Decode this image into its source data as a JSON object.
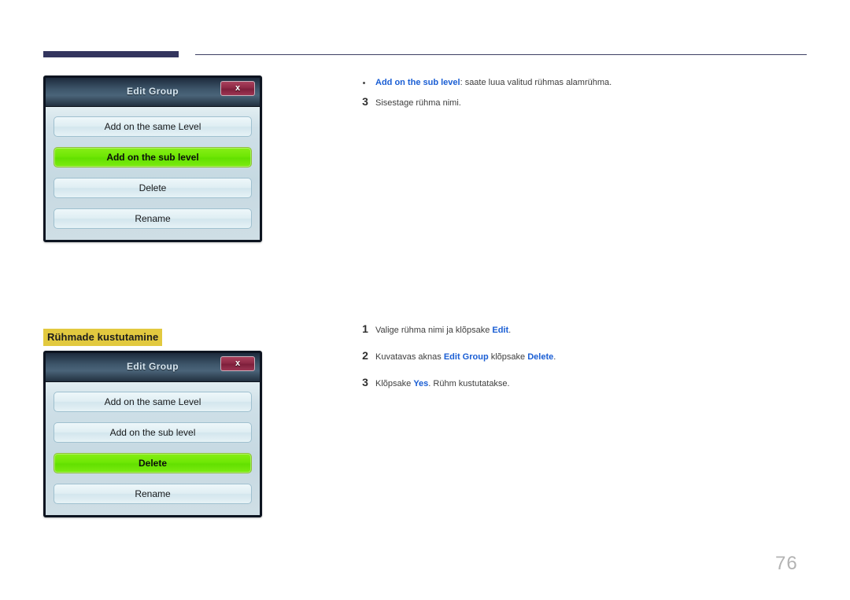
{
  "page": {
    "number": "76",
    "heading": "Rühmade kustutamine"
  },
  "header_rule": {
    "thick_color": "#33355e",
    "thin_color": "#3c3f63"
  },
  "colors": {
    "keyword_blue": "#1a5ed4",
    "highlight_yellow": "#e2c93f",
    "selected_green": "#6fe705",
    "close_button_red": "#8e2946"
  },
  "dialog_1": {
    "title": "Edit Group",
    "close_label": "x",
    "close_icon": "close-icon",
    "buttons": [
      {
        "label": "Add on the same Level",
        "selected": false
      },
      {
        "label": "Add on the sub level",
        "selected": true
      },
      {
        "label": "Delete",
        "selected": false
      },
      {
        "label": "Rename",
        "selected": false
      }
    ]
  },
  "dialog_2": {
    "title": "Edit Group",
    "close_label": "x",
    "close_icon": "close-icon",
    "buttons": [
      {
        "label": "Add on the same Level",
        "selected": false
      },
      {
        "label": "Add on the sub level",
        "selected": false
      },
      {
        "label": "Delete",
        "selected": true
      },
      {
        "label": "Rename",
        "selected": false
      }
    ]
  },
  "block_top": {
    "bullet": {
      "keyword": "Add on the sub level",
      "text": ": saate luua valitud rühmas alamrühma."
    },
    "step": {
      "num": "3",
      "text": "Sisestage rühma nimi."
    }
  },
  "block_bottom": {
    "steps": [
      {
        "num": "1",
        "pre": "Valige rühma nimi ja klõpsake ",
        "kw1": "Edit",
        "mid": ".",
        "kw2": "",
        "post": ""
      },
      {
        "num": "2",
        "pre": "Kuvatavas aknas ",
        "kw1": "Edit Group",
        "mid": " klõpsake ",
        "kw2": "Delete",
        "post": "."
      },
      {
        "num": "3",
        "pre": "Klõpsake ",
        "kw1": "Yes",
        "mid": ". Rühm kustutatakse.",
        "kw2": "",
        "post": ""
      }
    ]
  }
}
